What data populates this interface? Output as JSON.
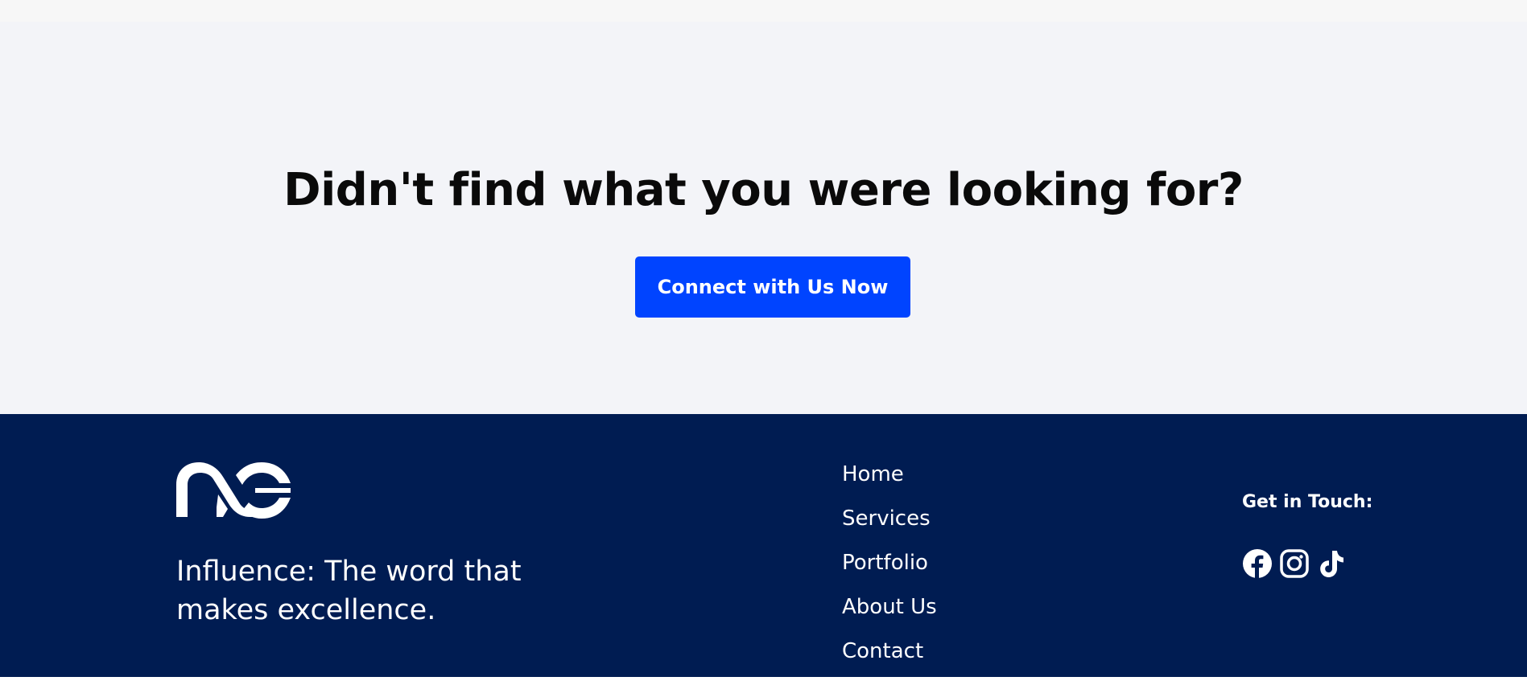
{
  "cta": {
    "heading": "Didn't find what you were looking for?",
    "button_label": "Connect with Us Now"
  },
  "footer": {
    "logo_icon": "nc-logo",
    "tagline": "Influence: The word that makes excellence.",
    "nav": [
      {
        "label": "Home"
      },
      {
        "label": "Services"
      },
      {
        "label": "Portfolio"
      },
      {
        "label": "About Us"
      },
      {
        "label": "Contact"
      }
    ],
    "contact_heading": "Get in Touch:",
    "social_icons": [
      "facebook-icon",
      "instagram-icon",
      "tiktok-icon"
    ]
  },
  "colors": {
    "accent": "#0044ff",
    "footer_bg": "#001c52",
    "cta_bg": "#f3f4f8"
  }
}
